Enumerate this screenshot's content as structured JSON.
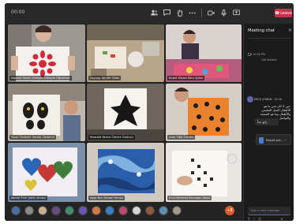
{
  "toolbar": {
    "timer": "00:00",
    "icons": [
      "people-icon",
      "chat-icon",
      "raise-hand-icon",
      "more-icon",
      "camera-icon",
      "mic-icon",
      "share-icon"
    ],
    "leave_label": "Leave"
  },
  "chat": {
    "title": "Meeting chat",
    "close_glyph": "×",
    "event_line": "Call started",
    "event_time": "12:00 PM",
    "sender": "ERCE ÇOBAN · 12:10",
    "message": "حين لا كان نحن ما هو للأطفال العمل التعليمي والأطفال وما هو الصفحة والتواصل",
    "reply": "رائع جداً",
    "file_name": "Result.pd... ⋯",
    "compose_placeholder": "Type a new message",
    "compose_icons": [
      "format-icon",
      "attach-icon",
      "emoji-icon",
      "send-icon"
    ]
  },
  "grid": {
    "tiles": [
      {
        "name": "Nisanur Sezer Ozkayla Ozkayla Öğretmen"
      },
      {
        "name": "Zeynep Nilüfer Göbe"
      },
      {
        "name": "Buket Yüksel Ebru Şahin"
      },
      {
        "name": "Yusuf Özdemir Serdar Özdemir"
      },
      {
        "name": "Mustafa Kemal Öztürk Ödünçü"
      },
      {
        "name": "Arda Yiğit Özmen"
      },
      {
        "name": "Kemal Emir Şahin Arslan"
      },
      {
        "name": "Ayşe Nur Yılmaz Yılmaz"
      },
      {
        "name": "Emir Mehmet Kocaalan Ailesi"
      }
    ]
  },
  "bottom_bar": {
    "avatar_icons": [
      "participant-avatar-1",
      "participant-avatar-2",
      "participant-avatar-3",
      "participant-avatar-4",
      "participant-avatar-5",
      "participant-avatar-6",
      "participant-avatar-7",
      "participant-avatar-8",
      "participant-avatar-9",
      "participant-avatar-10",
      "participant-avatar-11",
      "participant-avatar-12",
      "participant-avatar-13"
    ],
    "more_count": "+8"
  },
  "colors": {
    "window_bg": "#1f1f1f",
    "leave": "#c4314b",
    "accent": "#6264a7",
    "more_badge": "#e05a2b"
  }
}
